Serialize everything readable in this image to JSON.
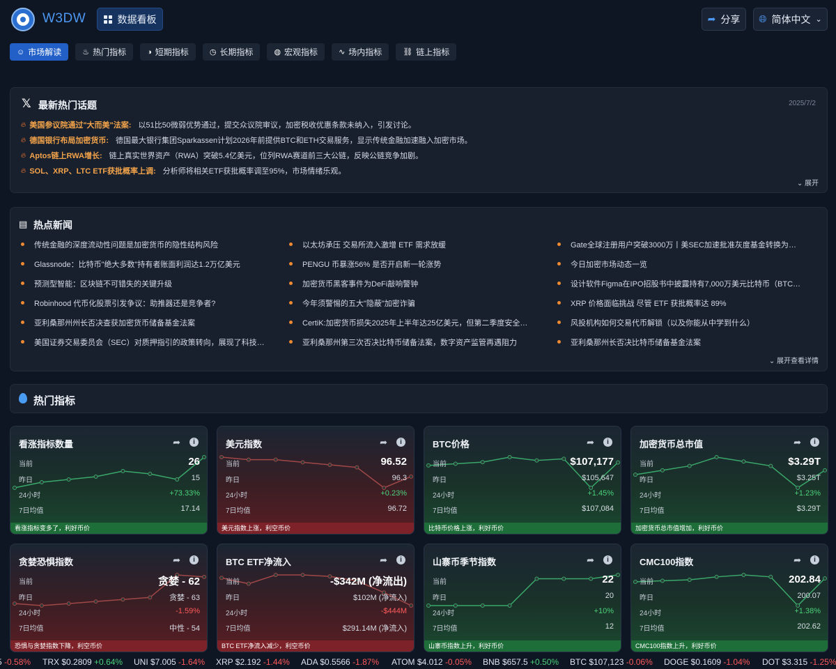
{
  "header": {
    "brand": "W3DW",
    "dashboard_label": "数据看板",
    "share_label": "分享",
    "language_label": "简体中文"
  },
  "tabs": [
    {
      "label": "市场解读",
      "icon": "robot-icon",
      "active": true
    },
    {
      "label": "热门指标",
      "icon": "fire-icon"
    },
    {
      "label": "短期指标",
      "icon": "contrast-icon"
    },
    {
      "label": "长期指标",
      "icon": "clock-icon"
    },
    {
      "label": "宏观指标",
      "icon": "globe-icon"
    },
    {
      "label": "场内指标",
      "icon": "pulse-icon"
    },
    {
      "label": "链上指标",
      "icon": "chain-icon"
    }
  ],
  "topics": {
    "title": "最新热门话题",
    "date": "2025/7/2",
    "expand_label": "展开",
    "items": [
      {
        "head": "美国参议院通过\"大而美\"法案:",
        "body": "以51比50微弱优势通过，提交众议院审议，加密税收优惠条款未纳入，引发讨论。"
      },
      {
        "head": "德国银行布局加密货币:",
        "body": "德国最大银行集团Sparkassen计划2026年前提供BTC和ETH交易服务，显示传统金融加速融入加密市场。"
      },
      {
        "head": "Aptos链上RWA增长:",
        "body": "链上真实世界资产（RWA）突破5.4亿美元，位列RWA赛道前三大公链，反映公链竞争加剧。"
      },
      {
        "head": "SOL、XRP、LTC ETF获批概率上调:",
        "body": "分析师将相关ETF获批概率调至95%，市场情绪乐观。"
      }
    ]
  },
  "news": {
    "title": "热点新闻",
    "expand_label": "展开查看详情",
    "col1": [
      "传统金融的深度流动性问题是加密货币的隐性结构风险",
      "Glassnode：比特币\"绝大多数\"持有者账面利润达1.2万亿美元",
      "预测型智能：区块链不可错失的关键升级",
      "Robinhood 代币化股票引发争议：助推器还是竞争者?",
      "亚利桑那州州长否决查获加密货币储备基金法案",
      "美国证券交易委员会（SEC）对质押指引的政策转向，展现了科技友好…"
    ],
    "col2": [
      "以太坊承压 交易所流入激增 ETF 需求放缓",
      "PENGU 币暴涨56% 是否开启新一轮涨势",
      "加密货币黑客事件为DeFi敲响警钟",
      "今年须警惕的五大\"隐蔽\"加密诈骗",
      "CertiK:加密货币损失2025年上半年达25亿美元，但第二季度安全事件…",
      "亚利桑那州第三次否决比特币储备法案，数字资产监管再遇阻力"
    ],
    "col3": [
      "Gate全球注册用户突破3000万丨美SEC加速批准灰度基金转换为ETF",
      "今日加密市场动态一览",
      "设计软件Figma在IPO招股书中披露持有7,000万美元比特币（BTC）ETF",
      "XRP 价格面临挑战 尽管 ETF 获批概率达 89%",
      "风投机构如何交易代币解锁（以及你能从中学到什么）",
      "亚利桑那州长否决比特币储备基金法案"
    ]
  },
  "hot_section": {
    "title": "热门指标"
  },
  "labels": {
    "current": "当前",
    "yesterday": "昨日",
    "change24": "24小时",
    "avg7": "7日均值"
  },
  "cards": [
    {
      "title": "看涨指标数量",
      "current": "26",
      "yesterday": "15",
      "change": "+73.33%",
      "avg": "17.14",
      "footer": "看涨指标变多了，利好币价",
      "trend": "up",
      "spark": [
        15,
        17,
        18,
        19,
        21,
        20,
        18,
        26
      ]
    },
    {
      "title": "美元指数",
      "current": "96.52",
      "yesterday": "96.3",
      "change": "+0.23%",
      "avg": "96.72",
      "footer": "美元指数上涨，利空币价",
      "trend": "down",
      "spark": [
        96.9,
        96.85,
        96.85,
        96.8,
        96.75,
        96.7,
        96.3,
        96.52
      ]
    },
    {
      "title": "BTC价格",
      "current": "$107,177",
      "yesterday": "$105,647",
      "change": "+1.45%",
      "avg": "$107,084",
      "footer": "比特币价格上涨，利好币价",
      "trend": "up",
      "spark": [
        107000,
        107100,
        107200,
        107500,
        107300,
        107400,
        105647,
        107177
      ]
    },
    {
      "title": "加密货币总市值",
      "current": "$3.29T",
      "yesterday": "$3.25T",
      "change": "+1.23%",
      "avg": "$3.29T",
      "footer": "加密货币总市值增加，利好币价",
      "trend": "up",
      "spark": [
        3.28,
        3.29,
        3.3,
        3.32,
        3.31,
        3.3,
        3.25,
        3.29
      ]
    },
    {
      "title": "贪婪恐惧指数",
      "current": "贪婪 - 62",
      "yesterday": "贪婪 - 63",
      "change": "-1.59%",
      "avg": "中性 - 54",
      "footer": "恐惧与贪婪指数下降，利空币价",
      "trend": "down",
      "spark": [
        49,
        48,
        49,
        50,
        51,
        52,
        63,
        62
      ]
    },
    {
      "title": "BTC ETF净流入",
      "current": "-$342M (净流出)",
      "yesterday": "$102M (净流入)",
      "change": "-$444M",
      "avg": "$291.14M (净流入)",
      "footer": "BTC ETF净流入减少，利空币价",
      "trend": "down",
      "spark": [
        600,
        400,
        700,
        700,
        650,
        500,
        102,
        -342
      ]
    },
    {
      "title": "山寨币季节指数",
      "current": "22",
      "yesterday": "20",
      "change": "+10%",
      "avg": "12",
      "footer": "山寨币指数上升，利好币价",
      "trend": "up",
      "spark": [
        6,
        6,
        6,
        6,
        20,
        20,
        20,
        22
      ]
    },
    {
      "title": "CMC100指数",
      "current": "202.84",
      "yesterday": "200.07",
      "change": "+1.38%",
      "avg": "202.62",
      "footer": "CMC100指数上升，利好币价",
      "trend": "up",
      "spark": [
        202.5,
        202.6,
        202.7,
        203,
        203.2,
        203,
        200.07,
        202.84
      ]
    }
  ],
  "ticker": [
    {
      "sym": "5",
      "price": "",
      "chg": "-0.58%"
    },
    {
      "sym": "TRX",
      "price": "$0.2809",
      "chg": "+0.64%"
    },
    {
      "sym": "UNI",
      "price": "$7.005",
      "chg": "-1.64%"
    },
    {
      "sym": "XRP",
      "price": "$2.192",
      "chg": "-1.44%"
    },
    {
      "sym": "ADA",
      "price": "$0.5566",
      "chg": "-1.87%"
    },
    {
      "sym": "ATOM",
      "price": "$4.012",
      "chg": "-0.05%"
    },
    {
      "sym": "BNB",
      "price": "$657.5",
      "chg": "+0.50%"
    },
    {
      "sym": "BTC",
      "price": "$107,123",
      "chg": "-0.06%"
    },
    {
      "sym": "DOGE",
      "price": "$0.1609",
      "chg": "-1.04%"
    },
    {
      "sym": "DOT",
      "price": "$3.315",
      "chg": "-1.25%"
    }
  ],
  "colors": {
    "accent": "#2260c8",
    "up": "#4bd27a",
    "down": "#ff5a5a",
    "brand": "#4d98f2"
  }
}
